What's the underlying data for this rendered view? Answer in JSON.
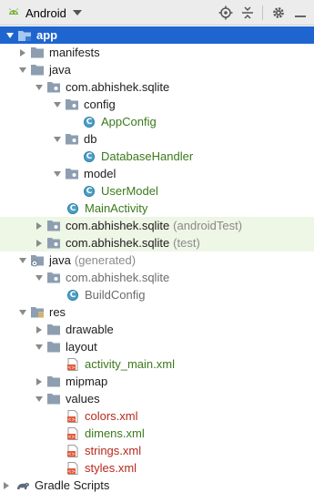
{
  "toolbar": {
    "view_label": "Android",
    "icons": [
      "android-icon",
      "chevron-down-icon",
      "locate-icon",
      "collapse-icon",
      "gear-icon",
      "hide-icon"
    ]
  },
  "tree": [
    {
      "label": "app",
      "suffix": ""
    },
    {
      "label": "manifests",
      "suffix": ""
    },
    {
      "label": "java",
      "suffix": ""
    },
    {
      "label": "com.abhishek.sqlite",
      "suffix": ""
    },
    {
      "label": "config",
      "suffix": ""
    },
    {
      "label": "AppConfig",
      "suffix": ""
    },
    {
      "label": "db",
      "suffix": ""
    },
    {
      "label": "DatabaseHandler",
      "suffix": ""
    },
    {
      "label": "model",
      "suffix": ""
    },
    {
      "label": "UserModel",
      "suffix": ""
    },
    {
      "label": "MainActivity",
      "suffix": ""
    },
    {
      "label": "com.abhishek.sqlite",
      "suffix": "(androidTest)"
    },
    {
      "label": "com.abhishek.sqlite",
      "suffix": "(test)"
    },
    {
      "label": "java",
      "suffix": "(generated)"
    },
    {
      "label": "com.abhishek.sqlite",
      "suffix": ""
    },
    {
      "label": "BuildConfig",
      "suffix": ""
    },
    {
      "label": "res",
      "suffix": ""
    },
    {
      "label": "drawable",
      "suffix": ""
    },
    {
      "label": "layout",
      "suffix": ""
    },
    {
      "label": "activity_main.xml",
      "suffix": ""
    },
    {
      "label": "mipmap",
      "suffix": ""
    },
    {
      "label": "values",
      "suffix": ""
    },
    {
      "label": "colors.xml",
      "suffix": ""
    },
    {
      "label": "dimens.xml",
      "suffix": ""
    },
    {
      "label": "strings.xml",
      "suffix": ""
    },
    {
      "label": "styles.xml",
      "suffix": ""
    },
    {
      "label": "Gradle Scripts",
      "suffix": ""
    }
  ],
  "colors": {
    "selection": "#1f65cf",
    "test_row_bg": "#eef6e6",
    "folder": "#8e9eb1",
    "class_icon": "#4ba0c8",
    "green_text": "#3a7a1c",
    "red_text": "#b52a1c"
  }
}
